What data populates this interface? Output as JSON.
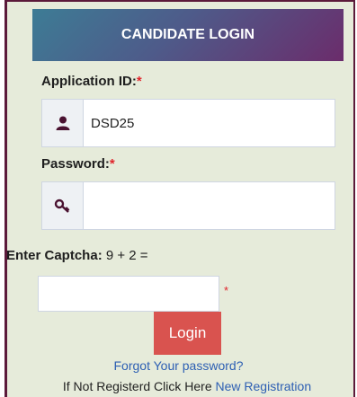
{
  "header": {
    "title": "CANDIDATE LOGIN"
  },
  "application_id": {
    "label": "Application ID:",
    "required": "*",
    "value": "DSD25",
    "icon": "user-icon"
  },
  "password": {
    "label": "Password:",
    "required": "*",
    "value": "",
    "icon": "key-icon"
  },
  "captcha": {
    "label": "Enter Captcha:",
    "question": "9 + 2 =",
    "value": "",
    "required": "*"
  },
  "buttons": {
    "login": "Login"
  },
  "links": {
    "forgot": "Forgot Your password?",
    "register_prefix": "If Not Registerd Click Here",
    "register": "New Registration"
  },
  "colors": {
    "accent_red": "#d9534f",
    "link_blue": "#2d5fb3",
    "panel_bg": "#e6ebda",
    "border": "#5b1a3a"
  }
}
